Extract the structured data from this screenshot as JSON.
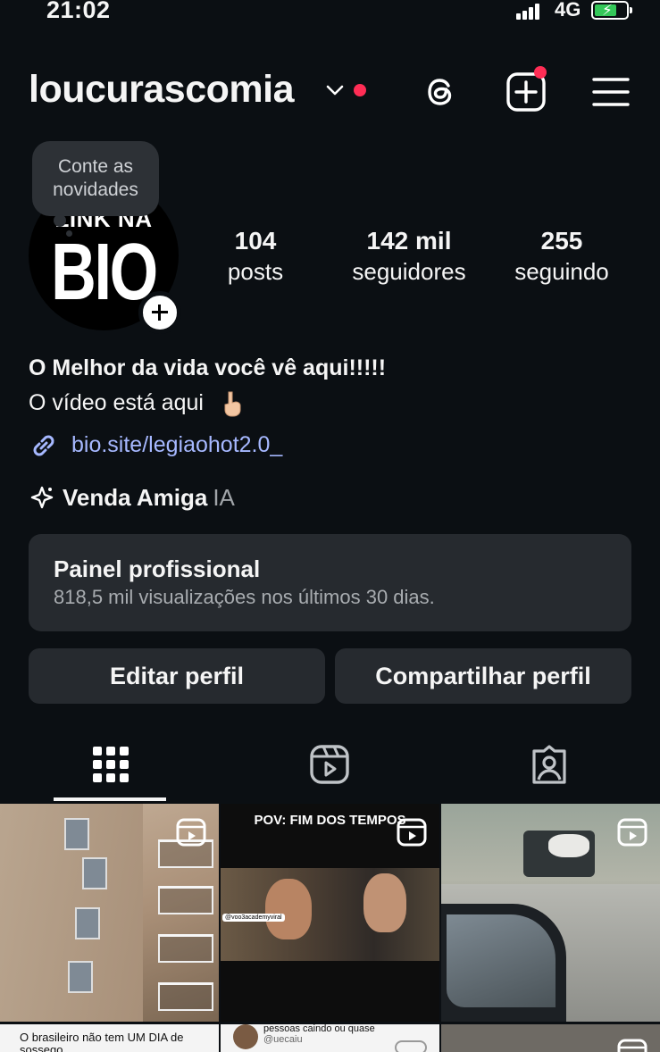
{
  "status_bar": {
    "time": "21:02",
    "network": "4G"
  },
  "header": {
    "username": "loucurascomia",
    "icons": [
      "chevron-down-icon",
      "threads-icon",
      "create-icon",
      "menu-icon"
    ]
  },
  "profile": {
    "note": "Conte as novidades",
    "avatar_text_top": "LINK NA",
    "avatar_text_big": "BIO",
    "stats": {
      "posts": {
        "value": "104",
        "label": "posts"
      },
      "followers": {
        "value": "142 mil",
        "label": "seguidores"
      },
      "following": {
        "value": "255",
        "label": "seguindo"
      }
    },
    "bio_title": "O Melhor da vida você vê aqui!!!!!",
    "bio_line": "O vídeo está aqui",
    "link": "bio.site/legiaohot2.0_",
    "ai_label": "Venda Amiga",
    "ai_badge": "IA"
  },
  "dashboard": {
    "title": "Painel profissional",
    "subtitle": "818,5 mil visualizações nos últimos 30 dias."
  },
  "actions": {
    "edit": "Editar perfil",
    "share": "Compartilhar perfil"
  },
  "tabs": [
    "grid-icon",
    "reels-icon",
    "tagged-icon"
  ],
  "grid": {
    "post2_caption": "POV: FIM DOS TEMPOS",
    "post2_tag": "@voo3academyviral",
    "post4_caption": "O brasileiro não tem UM DIA de sossego",
    "post5_caption": "pessoas caindo ou quase",
    "post5_handle": "@uecaiu"
  },
  "colors": {
    "background": "#0b0f13",
    "card": "#262a2f",
    "link": "#a6b8ff",
    "notification": "#ff2d55"
  }
}
